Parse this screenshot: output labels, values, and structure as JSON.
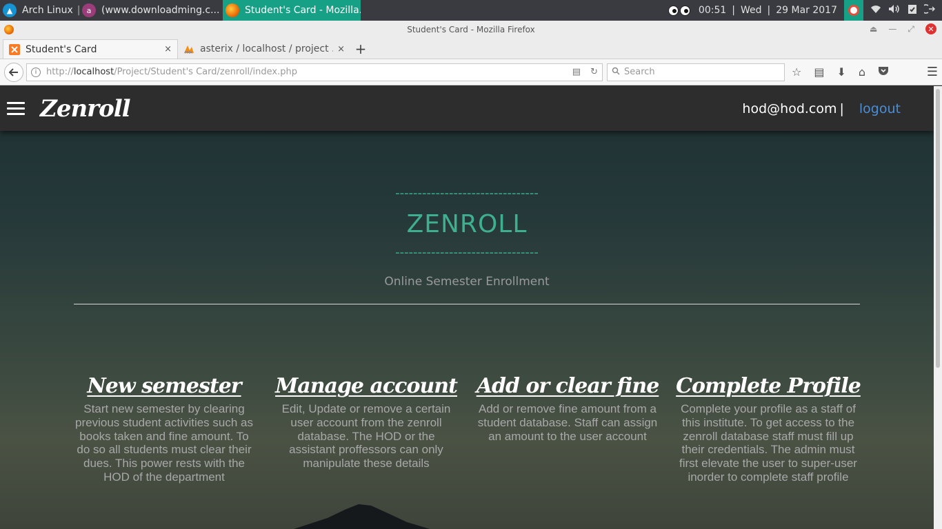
{
  "taskbar": {
    "tasks": [
      {
        "label": "Arch Linux",
        "sep": "|"
      },
      {
        "label": "(www.downloadming.c..."
      },
      {
        "label": "Student's Card - Mozilla..."
      }
    ],
    "clock": {
      "time": "00:51",
      "day": "Wed",
      "date": "29 Mar 2017",
      "sep": "|"
    }
  },
  "browser": {
    "window_title": "Student's Card - Mozilla Firefox",
    "tabs": [
      {
        "label": "Student's Card",
        "close": "×"
      },
      {
        "label": "asterix / localhost / project ...",
        "close": "×"
      }
    ],
    "new_tab": "+",
    "url_prefix": "http://",
    "url_host": "localhost",
    "url_path": "/Project/Student's Card/zenroll/index.php",
    "search_placeholder": "Search"
  },
  "site": {
    "brand": "Zenroll",
    "user_email": "hod@hod.com",
    "user_sep": "|",
    "logout": "logout",
    "dashes": "--------------------------------",
    "title": "ZENROLL",
    "subtitle": "Online Semester Enrollment",
    "features": [
      {
        "title": "New semester",
        "text": "Start new semester by clearing previous student activities such as books taken and fine amount. To do so all students must clear their dues. This power rests with the HOD of the department"
      },
      {
        "title": "Manage account",
        "text": "Edit, Update or remove a certain user account from the zenroll database. The HOD or the assistant proffessors can only manipulate these details"
      },
      {
        "title": "Add or clear fine",
        "text": "Add or remove fine amount from a student database. Staff can assign an amount to the user account"
      },
      {
        "title": "Complete Profile",
        "text": "Complete your profile as a staff of this institute. To get access to the zenroll database staff must fill up their credentials. The admin must first elevate the user to super-user inorder to complete staff profile"
      }
    ]
  },
  "colors": {
    "accent": "#3fb08f",
    "link": "#4a8fd6",
    "taskbar_active": "#16a085"
  }
}
